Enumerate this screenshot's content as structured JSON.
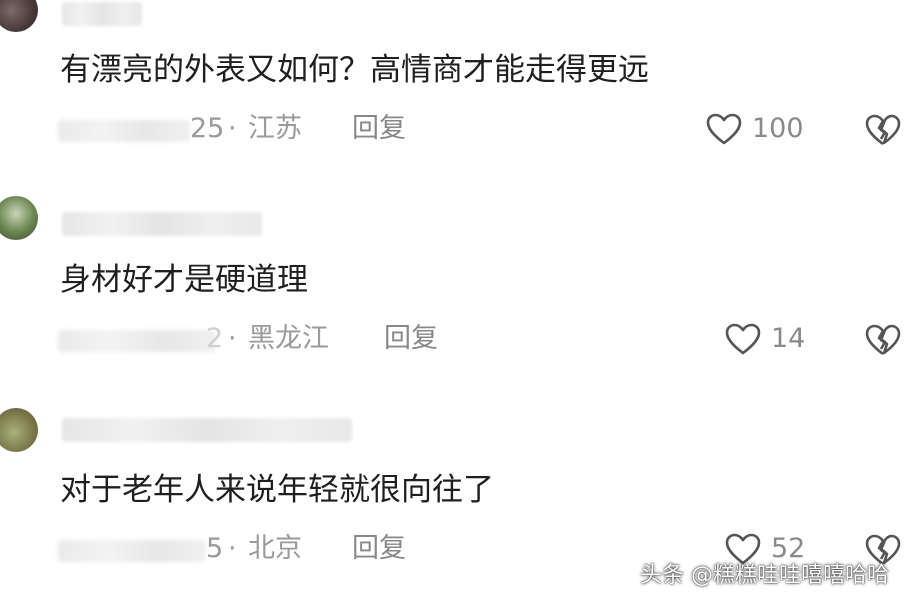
{
  "comments": [
    {
      "text": "有漂亮的外表又如何？高情商才能走得更远",
      "date_tail": "25",
      "separator": "·",
      "region": "江苏",
      "reply_label": "回复",
      "likes": "100"
    },
    {
      "text": "身材好才是硬道理",
      "date_tail": "2",
      "separator": "·",
      "region": "黑龙江",
      "reply_label": "回复",
      "likes": "14"
    },
    {
      "text": "对于老年人来说年轻就很向往了",
      "date_tail": "5",
      "separator": "·",
      "region": "北京",
      "reply_label": "回复",
      "likes": "52"
    }
  ],
  "watermark": "头条 @糕糕哇哇嘻嘻哈哈",
  "icons": {
    "like": "heart-outline-icon",
    "dislike": "broken-heart-icon"
  },
  "colors": {
    "text": "#1f1f1f",
    "meta": "#9a9a9a",
    "icon": "#555555"
  }
}
